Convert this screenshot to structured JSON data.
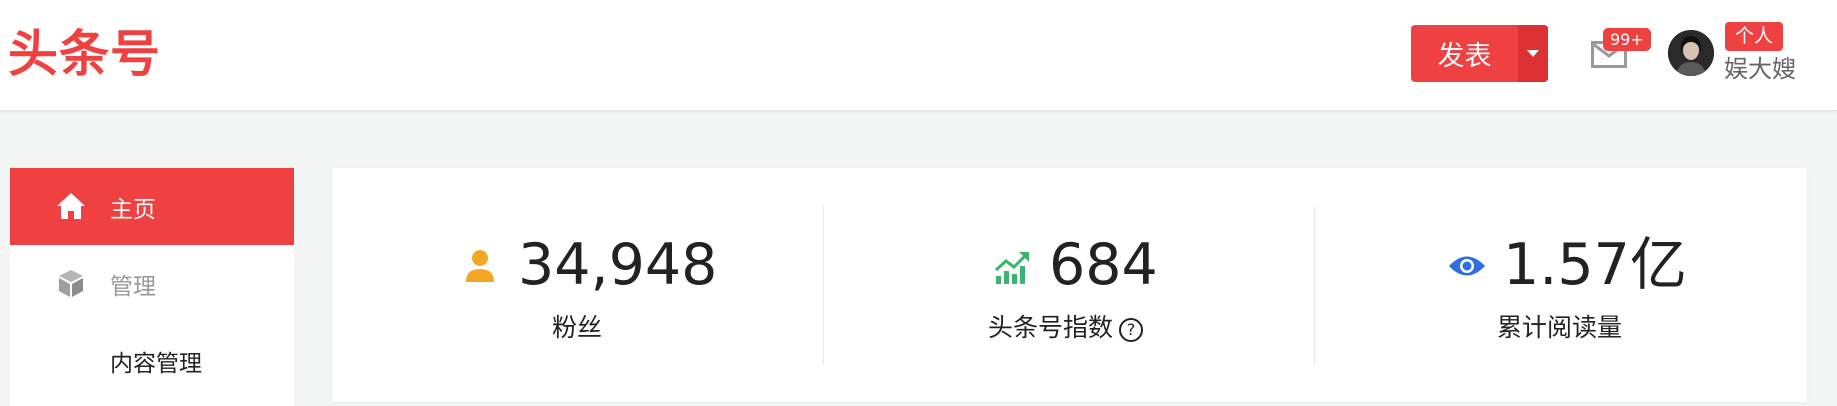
{
  "header": {
    "logo_text": "头条号",
    "publish_label": "发表",
    "mail_badge": "99+",
    "user_badge": "个人",
    "user_name": "娱大嫂"
  },
  "sidebar": {
    "items": [
      {
        "label": "主页",
        "icon": "home-icon",
        "active": true
      },
      {
        "label": "管理",
        "icon": "cube-icon",
        "active": false
      },
      {
        "label": "内容管理",
        "icon": "",
        "active": false
      }
    ]
  },
  "stats": [
    {
      "value": "34,948",
      "label": "粉丝",
      "icon": "user-icon",
      "color": "#f5a623"
    },
    {
      "value": "684",
      "label": "头条号指数",
      "icon": "trend-up-icon",
      "color": "#3cb371",
      "help": "?"
    },
    {
      "value": "1.57亿",
      "label": "累计阅读量",
      "icon": "eye-icon",
      "color": "#2e6fe0"
    }
  ],
  "colors": {
    "brand": "#f04142",
    "brand_dark": "#dc3133",
    "background": "#f3f4f4"
  }
}
